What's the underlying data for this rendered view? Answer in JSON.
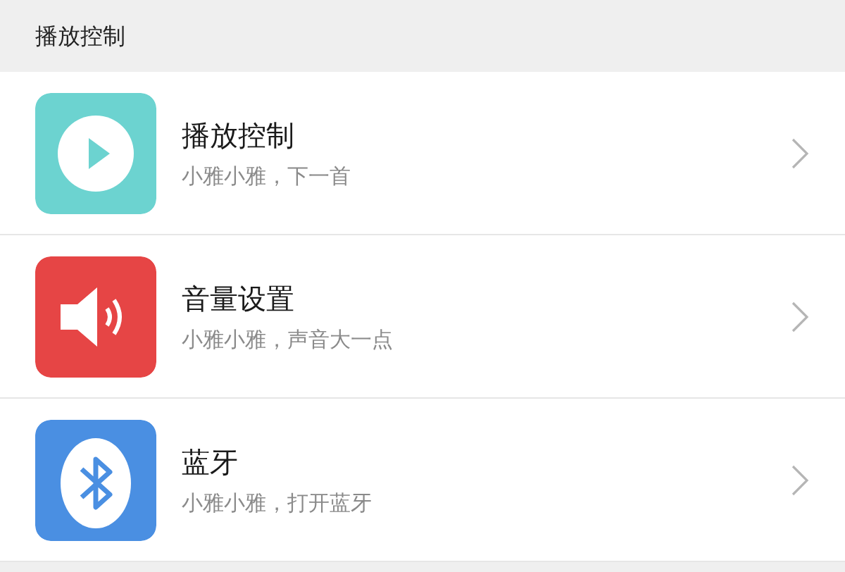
{
  "section_title": "播放控制",
  "items": [
    {
      "kind": "play",
      "color": "#6cd3d0",
      "title": "播放控制",
      "subtitle": "小雅小雅，下一首"
    },
    {
      "kind": "speaker",
      "color": "#e64545",
      "title": "音量设置",
      "subtitle": "小雅小雅，声音大一点"
    },
    {
      "kind": "bluetooth",
      "color": "#4a8fe2",
      "title": "蓝牙",
      "subtitle": "小雅小雅，打开蓝牙"
    }
  ]
}
